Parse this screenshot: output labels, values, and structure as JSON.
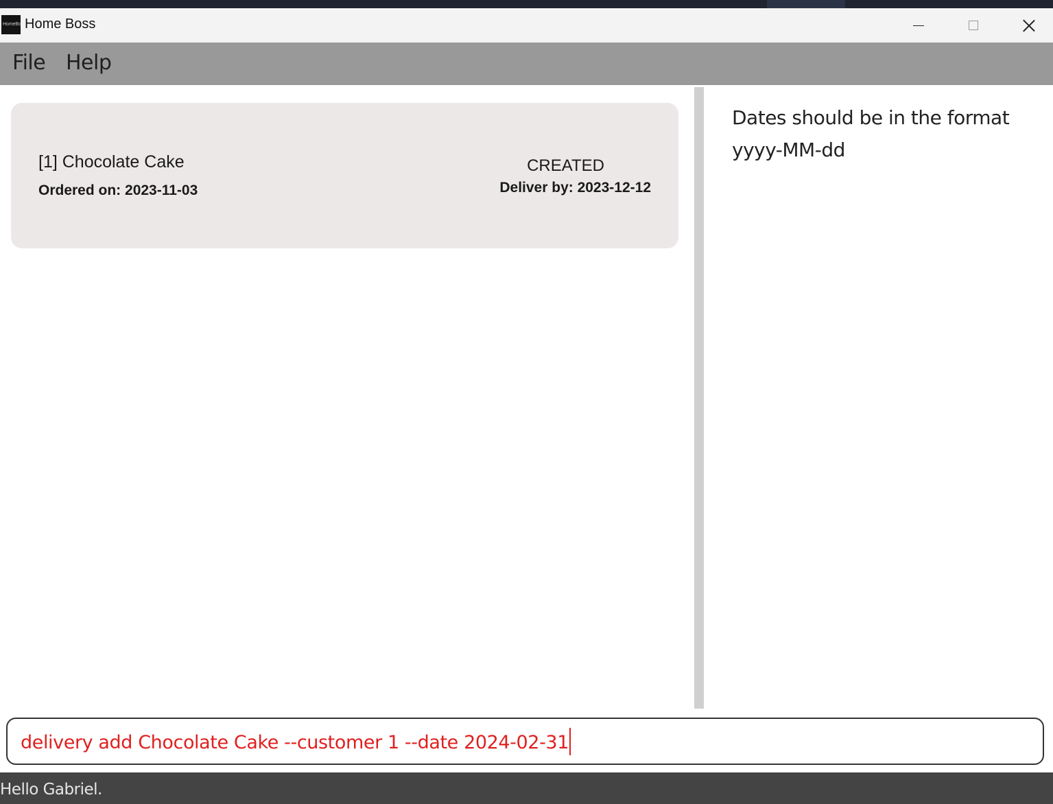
{
  "window": {
    "title": "Home Boss",
    "icon_text": "HomeBoss",
    "controls": [
      "minimize-icon",
      "maximize-icon",
      "close-icon"
    ]
  },
  "menu": {
    "items": [
      {
        "label": "File"
      },
      {
        "label": "Help"
      }
    ]
  },
  "deliveries": [
    {
      "title": "[1] Chocolate Cake",
      "ordered": "Ordered on: 2023-11-03",
      "status": "CREATED",
      "deliver_by": "Deliver by: 2023-12-12"
    }
  ],
  "result": {
    "message": "Dates should be in the format yyyy-MM-dd"
  },
  "command": {
    "value": "delivery add Chocolate Cake --customer 1 --date 2024-02-31",
    "color": "#e02020"
  },
  "status_bar": {
    "text": "Hello Gabriel."
  }
}
